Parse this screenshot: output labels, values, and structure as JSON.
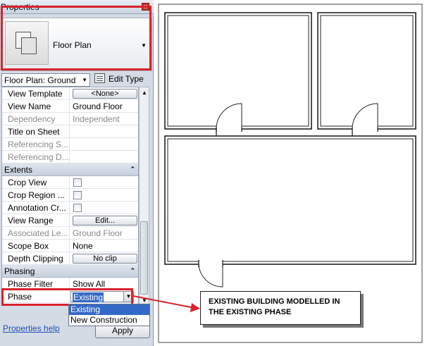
{
  "palette": {
    "title": "Properties",
    "close_glyph": "x",
    "type_selector": {
      "name": "Floor Plan",
      "icon": "floor-plan-icon",
      "arrow": "▼"
    },
    "instance_filter": {
      "value": "Floor Plan: Ground",
      "arrow": "▼"
    },
    "edit_type_label": "Edit Type",
    "groups": [
      {
        "label": "Extents",
        "collapse_glyph": "⌃"
      },
      {
        "label": "Phasing",
        "collapse_glyph": "⌃"
      }
    ],
    "rows": {
      "view_template": {
        "name": "View Template",
        "value": "<None>"
      },
      "view_name": {
        "name": "View Name",
        "value": "Ground Floor"
      },
      "dependency": {
        "name": "Dependency",
        "value": "Independent"
      },
      "title_on_sheet": {
        "name": "Title on Sheet",
        "value": ""
      },
      "referencing_s": {
        "name": "Referencing S...",
        "value": ""
      },
      "referencing_d": {
        "name": "Referencing D...",
        "value": ""
      },
      "crop_view": {
        "name": "Crop View",
        "checked": false
      },
      "crop_region": {
        "name": "Crop Region ...",
        "checked": false
      },
      "annotation_cr": {
        "name": "Annotation Cr...",
        "checked": false
      },
      "view_range": {
        "name": "View Range",
        "value": "Edit..."
      },
      "associated_le": {
        "name": "Associated Le...",
        "value": "Ground Floor"
      },
      "scope_box": {
        "name": "Scope Box",
        "value": "None"
      },
      "depth_clipping": {
        "name": "Depth Clipping",
        "value": "No clip"
      },
      "phase_filter": {
        "name": "Phase Filter",
        "value": "Show All"
      },
      "phase": {
        "name": "Phase",
        "value": "Existing"
      }
    },
    "phase_options": [
      "Existing",
      "New Construction"
    ],
    "help_link": "Properties help",
    "apply_label": "Apply"
  },
  "callout": {
    "line1": "EXISTING BUILDING MODELLED IN",
    "line2": "THE EXISTING PHASE"
  },
  "colors": {
    "highlight": "#d8232a",
    "selection": "#3369c6"
  }
}
